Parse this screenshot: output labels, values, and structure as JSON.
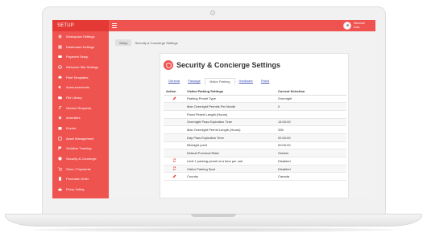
{
  "app": {
    "brand": "SETUP"
  },
  "sidebar": {
    "items": [
      {
        "label": "Workspace Settings",
        "icon": "settings-icon"
      },
      {
        "label": "Dashboard Settings",
        "icon": "dashboard-icon"
      },
      {
        "label": "Payment Setup",
        "icon": "card-icon"
      },
      {
        "label": "Welcome Site Settings",
        "icon": "globe-icon"
      },
      {
        "label": "Print Templates",
        "icon": "print-icon"
      },
      {
        "label": "Announcements",
        "icon": "megaphone-icon"
      },
      {
        "label": "File Library",
        "icon": "folder-icon"
      },
      {
        "label": "Service Requests",
        "icon": "wrench-icon"
      },
      {
        "label": "Amenities",
        "icon": "star-icon"
      },
      {
        "label": "Events",
        "icon": "calendar-icon"
      },
      {
        "label": "Asset Management",
        "icon": "box-icon"
      },
      {
        "label": "Violation Tracking",
        "icon": "flag-icon"
      },
      {
        "label": "Security & Concierge",
        "icon": "shield-icon"
      },
      {
        "label": "Store / Payments",
        "icon": "cart-icon"
      },
      {
        "label": "Purchase Order",
        "icon": "receipt-icon"
      },
      {
        "label": "Proxy Voting",
        "icon": "vote-icon"
      }
    ]
  },
  "topbar": {
    "menu_icon": "hamburger-icon",
    "user_welcome": "Welcome!",
    "user_name": "Dolo"
  },
  "breadcrumb": {
    "root": "Setup",
    "current": "Security & Concierge Settings"
  },
  "panel": {
    "title": "Security & Concierge Settings",
    "icon": "shield-icon",
    "accent": "#ef5350",
    "tabs": [
      {
        "label": "General",
        "active": false
      },
      {
        "label": "Package",
        "active": false
      },
      {
        "label": "Visitor Parking",
        "active": true
      },
      {
        "label": "Hardware",
        "active": false
      },
      {
        "label": "Patrol",
        "active": false
      }
    ]
  },
  "table": {
    "headers": [
      "Action",
      "Visitor Parking Settings",
      "Current Selection"
    ],
    "rows": [
      {
        "action": "edit-icon",
        "setting": "Parking Permit Type",
        "value": "Overnight"
      },
      {
        "action": "",
        "setting": "Max Overnight Permits Per Month",
        "value": "0"
      },
      {
        "action": "",
        "setting": "Fixed Permit Length (Hours)",
        "value": ""
      },
      {
        "action": "",
        "setting": "Overnight Pass Expiration Time",
        "value": "14:00:00"
      },
      {
        "action": "",
        "setting": "Max Overnight Permit Length (Hours)",
        "value": "336"
      },
      {
        "action": "",
        "setting": "Day Pass Expiration Time",
        "value": "02:00:00"
      },
      {
        "action": "",
        "setting": "Midnight point",
        "value": "00:00:00"
      },
      {
        "action": "",
        "setting": "Default Province/State",
        "value": "Ontario"
      },
      {
        "action": "toggle-icon",
        "setting": "Limit 1 parking permit at a time per unit",
        "value": "Disabled"
      },
      {
        "action": "toggle-icon",
        "setting": "Visitor Parking Spot",
        "value": "Disabled"
      },
      {
        "action": "edit-icon",
        "setting": "Country",
        "value": "Canada"
      }
    ]
  }
}
